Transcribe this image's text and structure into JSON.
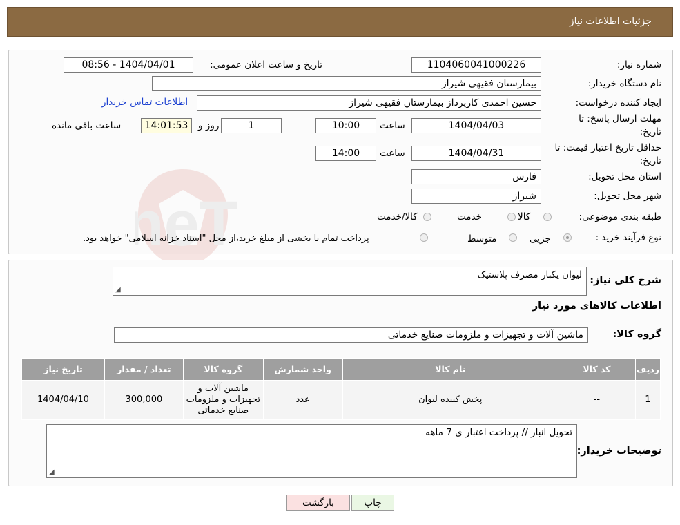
{
  "header": {
    "title": "جزئیات اطلاعات نیاز"
  },
  "watermark": {
    "text": "AriaTender.neT"
  },
  "info": {
    "need_number_label": "شماره نیاز:",
    "need_number": "1104060041000226",
    "announce_label": "تاریخ و ساعت اعلان عمومی:",
    "announce_value": "1404/04/01 - 08:56",
    "buyer_org_label": "نام دستگاه خریدار:",
    "buyer_org": "بیمارستان فقیهی شیراز",
    "creator_label": "ایجاد کننده درخواست:",
    "creator": "حسین احمدی کارپرداز بیمارستان فقیهی شیراز",
    "contact_link": "اطلاعات تماس خریدار",
    "deadline_label_line1": "مهلت ارسال پاسخ: تا",
    "deadline_label_line2": "تاریخ:",
    "deadline_date": "1404/04/03",
    "time_label": "ساعت",
    "deadline_time": "10:00",
    "days_value": "1",
    "days_label": "روز و",
    "remaining_time": "14:01:53",
    "remaining_label": "ساعت باقی مانده",
    "validity_label_line1": "حداقل تاریخ اعتبار قیمت: تا",
    "validity_label_line2": "تاریخ:",
    "validity_date": "1404/04/31",
    "validity_time": "14:00",
    "province_label": "استان محل تحویل:",
    "province": "فارس",
    "city_label": "شهر محل تحویل:",
    "city": "شیراز",
    "category_label": "طبقه بندی موضوعی:",
    "category_options": [
      "کالا",
      "خدمت",
      "کالا/خدمت"
    ],
    "process_label": "نوع فرآیند خرید :",
    "process_options": [
      "جزیی",
      "متوسط"
    ],
    "process_note": "پرداخت تمام یا بخشی از مبلغ خرید،از محل \"اسناد خزانه اسلامی\" خواهد بود."
  },
  "details": {
    "summary_label": "شرح کلی نیاز:",
    "summary": "لیوان یکبار مصرف پلاستیک",
    "goods_info_title": "اطلاعات کالاهای مورد نیاز",
    "goods_group_label": "گروه کالا:",
    "goods_group": "ماشین آلات و تجهیزات و ملزومات صنایع خدماتی",
    "table": {
      "headers": [
        "ردیف",
        "کد کالا",
        "نام کالا",
        "واحد شمارش",
        "گروه کالا",
        "تعداد / مقدار",
        "تاریخ نیاز"
      ],
      "rows": [
        [
          "1",
          "--",
          "پخش کننده لیوان",
          "عدد",
          "ماشین آلات و تجهیزات و ملزومات صنایع خدماتی",
          "300,000",
          "1404/04/10"
        ]
      ]
    },
    "buyer_notes_label": "توضیحات خریدار:",
    "buyer_notes": "تحویل انبار // پرداخت اعتبار ی 7 ماهه"
  },
  "buttons": {
    "print": "چاپ",
    "back": "بازگشت"
  }
}
